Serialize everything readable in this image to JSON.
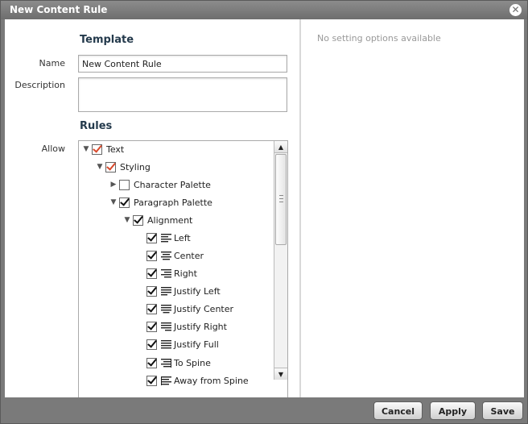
{
  "dialog": {
    "title": "New Content Rule",
    "close_icon": "close-icon"
  },
  "template": {
    "heading": "Template",
    "name_label": "Name",
    "name_value": "New Content Rule",
    "description_label": "Description",
    "description_value": ""
  },
  "rules": {
    "heading": "Rules",
    "allow_label": "Allow",
    "tree": [
      {
        "label": "Text",
        "expanded": true,
        "checked": true,
        "style": "red"
      },
      {
        "label": "Styling",
        "expanded": true,
        "checked": true,
        "style": "red"
      },
      {
        "label": "Character Palette",
        "expanded": false,
        "checked": false,
        "style": "black"
      },
      {
        "label": "Paragraph Palette",
        "expanded": true,
        "checked": true,
        "style": "black"
      },
      {
        "label": "Alignment",
        "expanded": true,
        "checked": true,
        "style": "black"
      },
      {
        "label": "Left",
        "checked": true,
        "icon": "align-left-icon"
      },
      {
        "label": "Center",
        "checked": true,
        "icon": "align-center-icon"
      },
      {
        "label": "Right",
        "checked": true,
        "icon": "align-right-icon"
      },
      {
        "label": "Justify Left",
        "checked": true,
        "icon": "justify-left-icon"
      },
      {
        "label": "Justify Center",
        "checked": true,
        "icon": "justify-center-icon"
      },
      {
        "label": "Justify Right",
        "checked": true,
        "icon": "justify-right-icon"
      },
      {
        "label": "Justify Full",
        "checked": true,
        "icon": "justify-full-icon"
      },
      {
        "label": "To Spine",
        "checked": true,
        "icon": "align-to-spine-icon"
      },
      {
        "label": "Away from Spine",
        "checked": true,
        "icon": "align-away-from-spine-icon"
      }
    ]
  },
  "settings": {
    "message": "No setting options available"
  },
  "footer": {
    "cancel_label": "Cancel",
    "apply_label": "Apply",
    "save_label": "Save"
  },
  "colors": {
    "heading": "#243a4c",
    "check_red": "#d8492b",
    "titlebar": "#7a7a7a"
  }
}
